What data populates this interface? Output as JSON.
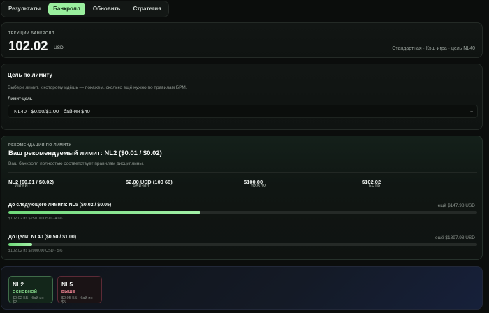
{
  "tabs": [
    {
      "label": "Результаты",
      "active": false
    },
    {
      "label": "Банкролл",
      "active": true
    },
    {
      "label": "Обновить",
      "active": false
    },
    {
      "label": "Стратегия",
      "active": false
    }
  ],
  "bankroll": {
    "label": "ТЕКУЩИЙ БАНКРОЛЛ",
    "amount": "102.02",
    "currency": "USD",
    "meta": "Стандартная · Кэш-игра · цель NL40"
  },
  "target": {
    "heading": "Цель по лимиту",
    "description": "Выбери лимит, к которому идёшь — покажем, сколько ещё нужно по правилам БРМ.",
    "field_label": "Лимит-цель",
    "selected": "NL40 · $0.50/$1.00 · бай-ин $40",
    "chevron": "⌄"
  },
  "recommendation": {
    "label": "РЕКОМЕНДАЦИЯ ПО ЛИМИТУ",
    "title": "Ваш рекомендуемый лимит: NL2 ($0.01 / $0.02)",
    "description": "Ваш банкролл полностью соответствует правилам дисциплины.",
    "stats": [
      {
        "label": "ЛИМИТ",
        "value": "NL2 ($0.01 / $0.02)"
      },
      {
        "label": "БАЙ-ИН",
        "value": "$2.00 USD (100 66)"
      },
      {
        "label": "НУЖНО",
        "value": "$100.00"
      },
      {
        "label": "ЕСТЬ",
        "value": "$102.02"
      }
    ],
    "next": {
      "title": "До следующего лимита: NL5 ($0.02 / $0.05)",
      "need": "ещё $147.98 USD",
      "progress": 0.41,
      "sub": "$102.02 из $250.00 USD · 41%"
    },
    "goal": {
      "title": "До цели: NL40 ($0.50 / $1.00)",
      "need": "ещё $1897.98 USD",
      "progress": 0.05,
      "sub": "$102.02 из $2000.00 USD · 5%"
    }
  },
  "limits": [
    {
      "name": "NL2",
      "tag": "ОСНОВНОЙ",
      "sub": "$0.02 ББ · бай-ин $2"
    },
    {
      "name": "NL5",
      "tag": "ВЫШЕ",
      "sub": "$0.05 ББ · бай-ин $5"
    }
  ],
  "colors": {
    "accent": "#9aef9e",
    "progress": "#6fd97a",
    "higher": "#ff8b9c",
    "background": "#0b0d0c"
  }
}
